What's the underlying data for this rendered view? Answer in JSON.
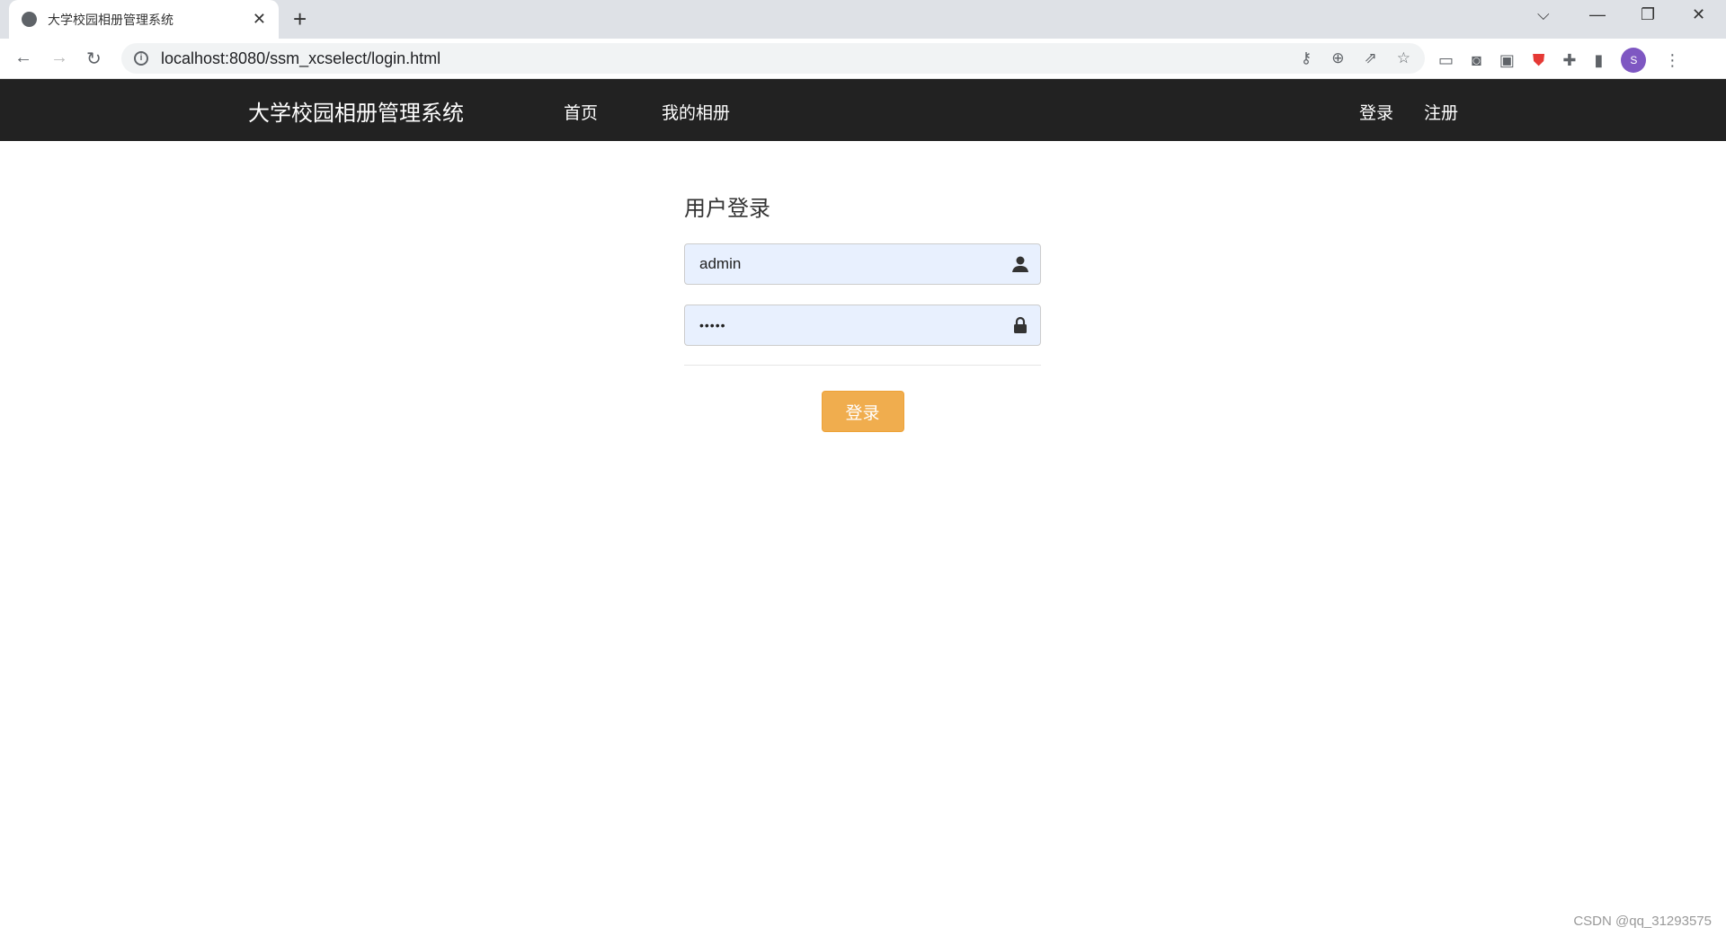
{
  "browser": {
    "tab_title": "大学校园相册管理系统",
    "url": "localhost:8080/ssm_xcselect/login.html",
    "avatar_letter": "S"
  },
  "navbar": {
    "brand": "大学校园相册管理系统",
    "links": [
      "首页",
      "我的相册"
    ],
    "right_links": [
      "登录",
      "注册"
    ]
  },
  "login": {
    "title": "用户登录",
    "username": "admin",
    "password": "•••••",
    "submit": "登录"
  },
  "watermark": "CSDN @qq_31293575",
  "colors": {
    "navbar": "#222222",
    "button": "#f0ad4e",
    "input_bg": "#e8f0fe"
  }
}
